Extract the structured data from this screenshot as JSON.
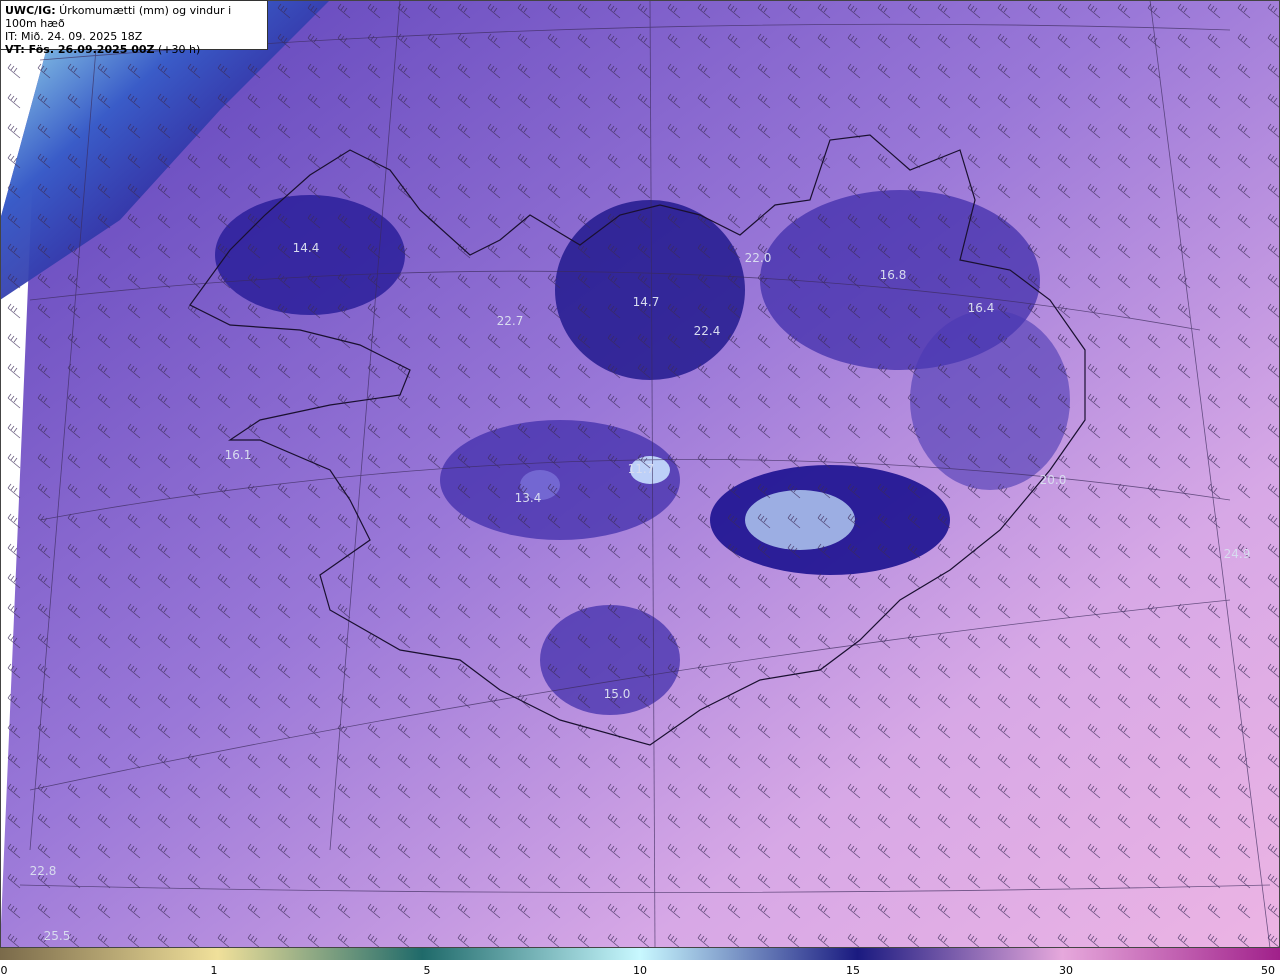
{
  "header": {
    "model": "UWC/IG:",
    "title_rest": " Úrkomumætti (mm) og vindur i 100m hæð",
    "it_line": "IT: Mið. 24. 09. 2025 18Z",
    "vt_label": "VT: Fös. 26.09.2025 00Z",
    "vt_offset": " (+30 h)"
  },
  "values": [
    {
      "id": "v1",
      "text": "14.4"
    },
    {
      "id": "v2",
      "text": "22.7"
    },
    {
      "id": "v3",
      "text": "14.7"
    },
    {
      "id": "v4",
      "text": "22.4"
    },
    {
      "id": "v5",
      "text": "22.0"
    },
    {
      "id": "v6",
      "text": "16.8"
    },
    {
      "id": "v7",
      "text": "16.4"
    },
    {
      "id": "v8",
      "text": "16.1"
    },
    {
      "id": "v9",
      "text": "13.4"
    },
    {
      "id": "v10",
      "text": "11.7"
    },
    {
      "id": "v11",
      "text": "20.0"
    },
    {
      "id": "v12",
      "text": "24.9"
    },
    {
      "id": "v13",
      "text": "15.0"
    },
    {
      "id": "v14",
      "text": "22.8"
    },
    {
      "id": "v15",
      "text": "25.5"
    }
  ],
  "colorbar": {
    "ticks": [
      "0",
      "1",
      "5",
      "10",
      "15",
      "30",
      "50"
    ],
    "stops": [
      "#7a6a4a",
      "#f0e09a",
      "#1f6a6a",
      "#c8f8ff",
      "#1a1a80",
      "#e6a8dc",
      "#a0208a"
    ]
  }
}
